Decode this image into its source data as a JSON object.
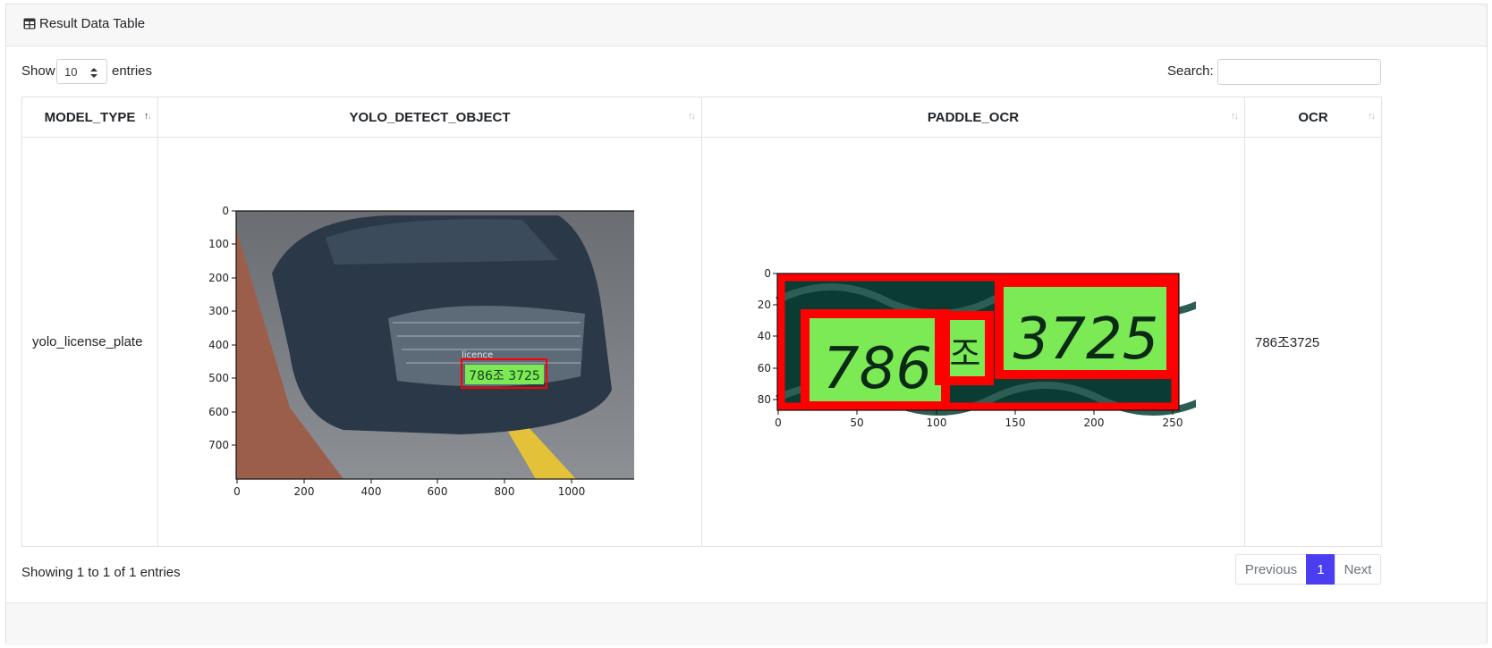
{
  "card": {
    "title": "Result Data Table",
    "title_icon": "table-icon"
  },
  "length_menu": {
    "prefix": "Show",
    "value": "10",
    "suffix": "entries"
  },
  "search": {
    "label": "Search:",
    "value": ""
  },
  "columns": [
    "MODEL_TYPE",
    "YOLO_DETECT_OBJECT",
    "PADDLE_OCR",
    "OCR"
  ],
  "rows": [
    {
      "model_type": "yolo_license_plate",
      "ocr": "786조3725"
    }
  ],
  "yolo_plot": {
    "x_ticks": [
      "0",
      "200",
      "400",
      "600",
      "800",
      "1000"
    ],
    "y_ticks": [
      "0",
      "100",
      "200",
      "300",
      "400",
      "500",
      "600",
      "700"
    ],
    "box_label": "licence",
    "plate_text": "786조 3725"
  },
  "paddle_plot": {
    "x_ticks": [
      "0",
      "50",
      "100",
      "150",
      "200",
      "250"
    ],
    "y_ticks": [
      "0",
      "20",
      "40",
      "60",
      "80"
    ],
    "segments": [
      "786",
      "조",
      "3725"
    ]
  },
  "info": "Showing 1 to 1 of 1 entries",
  "pagination": {
    "previous": "Previous",
    "current": "1",
    "next": "Next"
  },
  "colors": {
    "accent": "#4a3ef0",
    "box_red": "#ff0000",
    "plate_green": "#7bea55"
  }
}
